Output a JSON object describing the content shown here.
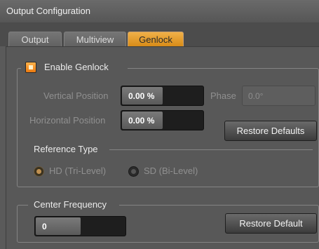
{
  "window": {
    "title": "Output Configuration"
  },
  "tabs": [
    {
      "label": "Output",
      "active": false
    },
    {
      "label": "Multiview",
      "active": false
    },
    {
      "label": "Genlock",
      "active": true
    }
  ],
  "genlock": {
    "enable_label": "Enable Genlock",
    "enabled": true,
    "vertical_position": {
      "label": "Vertical Position",
      "value": "0.00 %"
    },
    "horizontal_position": {
      "label": "Horizontal Position",
      "value": "0.00 %"
    },
    "phase": {
      "label": "Phase",
      "value": "0.0°"
    },
    "restore_defaults_label": "Restore Defaults",
    "reference_type": {
      "label": "Reference Type",
      "options": [
        {
          "label": "HD (Tri-Level)",
          "selected": true
        },
        {
          "label": "SD (Bi-Level)",
          "selected": false
        }
      ]
    }
  },
  "center_frequency": {
    "label": "Center Frequency",
    "value": "0",
    "restore_default_label": "Restore Default"
  },
  "colors": {
    "accent": "#e8962a",
    "panel": "#585858",
    "field": "#1e1e1e"
  }
}
